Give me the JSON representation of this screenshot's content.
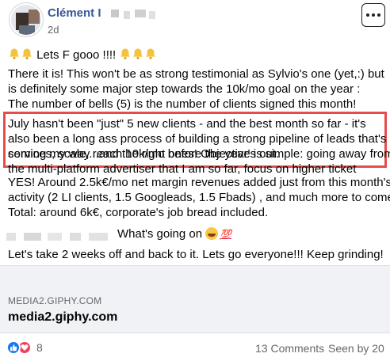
{
  "post": {
    "author": "Clément I",
    "timestamp": "2d",
    "lines": {
      "l1_text": "Lets F gooo !!!!",
      "l2": "There it is! This won't be as strong testimonial as Sylvio's one (yet,:) but",
      "l3": "is definitely some major step towards the 10k/mo goal on the year :",
      "l4": "The number of bells (5) is the number of clients signed this month!",
      "l5": "July hasn't been \"just\" 5 new clients - and the best month so far - it's",
      "l6": "also been a long ass process of building a strong pipeline of leads that's",
      "l7": "coming my way...and the right ones! Objective is simple: going away from",
      "l8": "the multi-platform advertiser that I am so far, focus on higher ticket",
      "l9": "services, scale, reach 10k/mo before the year's out.",
      "l10": "YES! Around 2.5k€/mo net margin revenues added just from this month's",
      "l11": "activity (2 LI clients, 1.5 Googleads, 1.5 Fbads) , and much more to come.",
      "l12": "Total: around 6k€, corporate's job bread included.",
      "l13": "What's going on",
      "l13_emoji": "💯",
      "l14": "Let's take 2 weeks off and back to it. Lets go everyone!!! Keep grinding!"
    },
    "link_preview": {
      "domain": "MEDIA2.GIPHY.COM",
      "title": "media2.giphy.com"
    },
    "footer": {
      "reaction_count": "8",
      "comments": "13 Comments",
      "seen": "Seen by 20"
    }
  },
  "colors": {
    "author": "#385898",
    "highlight_border": "#e74c4c",
    "bell": "#f5c33b",
    "like": "#1877f2",
    "love": "#f33e58"
  },
  "icons": [
    "bell-icon",
    "more-options-icon",
    "like-reaction-icon",
    "love-reaction-icon",
    "laughing-emoji-icon"
  ]
}
